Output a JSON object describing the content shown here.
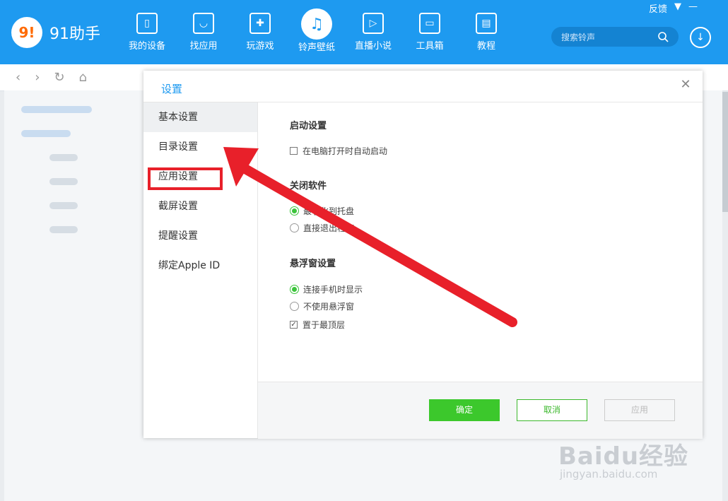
{
  "app": {
    "name": "91助手",
    "logo_mark": "9!"
  },
  "window_controls": {
    "feedback": "反馈",
    "menu_icon": "menu-icon",
    "minimize_icon": "minimize-icon"
  },
  "nav": [
    {
      "label": "我的设备",
      "icon": "device-icon",
      "glyph": "▯"
    },
    {
      "label": "找应用",
      "icon": "bag-icon",
      "glyph": "◡"
    },
    {
      "label": "玩游戏",
      "icon": "gamepad-icon",
      "glyph": "✚"
    },
    {
      "label": "铃声壁纸",
      "icon": "music-note-icon",
      "glyph": "♫",
      "active": true
    },
    {
      "label": "直播小说",
      "icon": "play-icon",
      "glyph": "▷"
    },
    {
      "label": "工具箱",
      "icon": "toolbox-icon",
      "glyph": "▭"
    },
    {
      "label": "教程",
      "icon": "clipboard-icon",
      "glyph": "▤"
    }
  ],
  "search": {
    "placeholder": "搜索铃声",
    "icon": "search-icon"
  },
  "dialog": {
    "title": "设置",
    "side_items": [
      "基本设置",
      "目录设置",
      "应用设置",
      "截屏设置",
      "提醒设置",
      "绑定Apple ID"
    ],
    "active_index": 0,
    "highlighted_index": 1,
    "sections": {
      "startup": {
        "title": "启动设置",
        "option": "在电脑打开时自动启动",
        "checked": false
      },
      "close": {
        "title": "关闭软件",
        "options": [
          "最小化到托盘",
          "直接退出程序"
        ],
        "selected": 0
      },
      "float": {
        "title": "悬浮窗设置",
        "options": [
          "连接手机时显示",
          "不使用悬浮窗"
        ],
        "selected": 0,
        "top_option": "置于最顶层",
        "top_checked": true
      }
    },
    "buttons": {
      "ok": "确定",
      "cancel": "取消",
      "apply": "应用"
    }
  },
  "watermark": {
    "main": "Baidu经验",
    "sub": "jingyan.baidu.com"
  },
  "colors": {
    "brand_blue": "#1e9af0",
    "accent_green": "#3cc82c",
    "highlight_red": "#e8202a"
  }
}
